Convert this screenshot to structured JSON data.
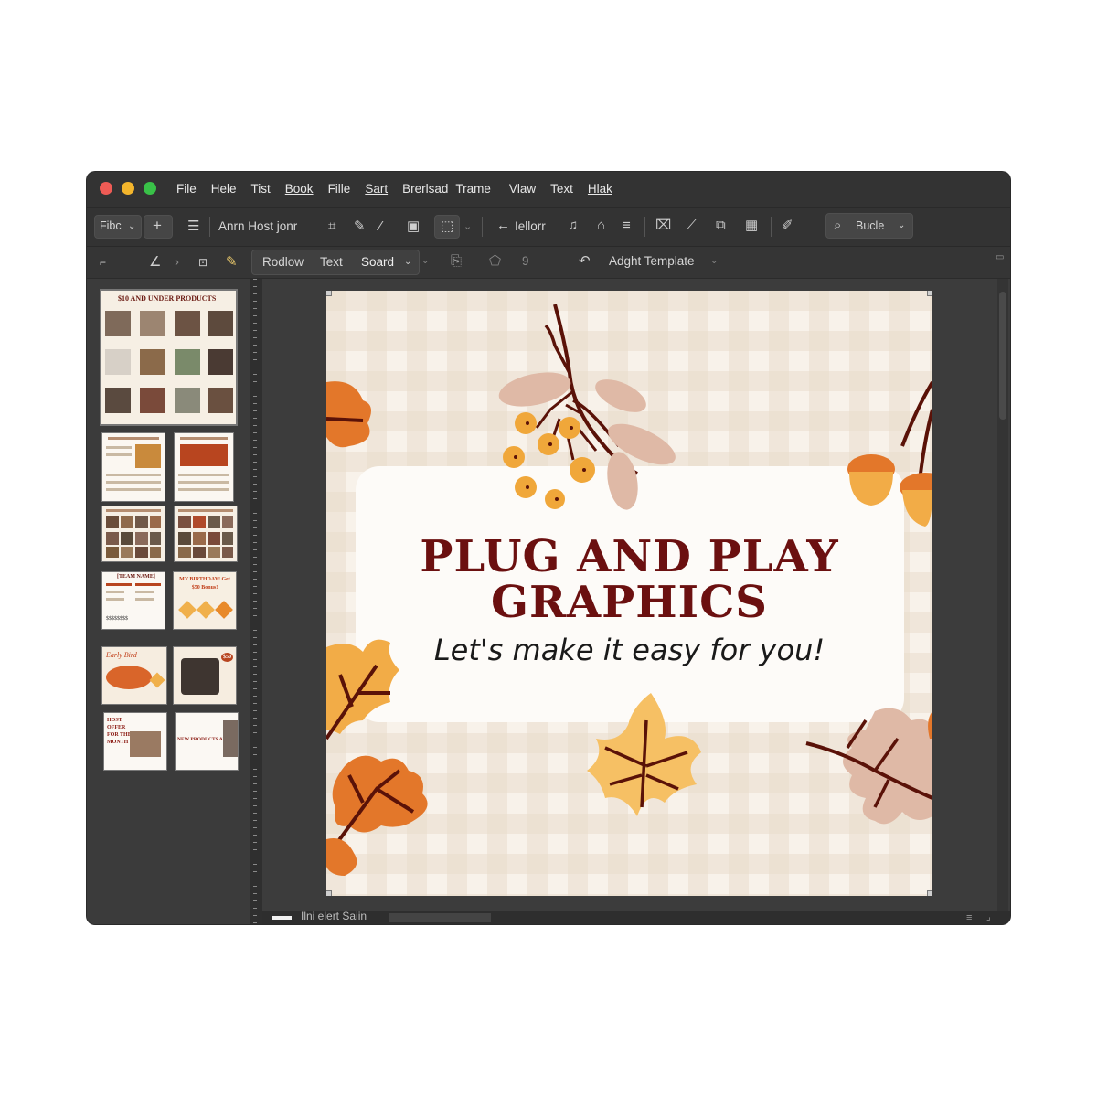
{
  "menubar": {
    "items": [
      "File",
      "Hele",
      "Tist",
      "Book",
      "Fille",
      "Sart",
      "Brerlsad",
      "Trame",
      "Vlaw",
      "Text",
      "Hlak"
    ]
  },
  "toolbar1": {
    "font_dropdown": "Fibc",
    "text_label": "Anrn Host jonr",
    "nav_label": "Iellorr",
    "search_label": "Bucle"
  },
  "toolbar2": {
    "tabs": [
      "Rodlow",
      "Text",
      "Soard"
    ],
    "number_value": "9",
    "template_label": "Adght Template"
  },
  "pages_panel": {
    "thumb1_title": "$10 AND UNDER PRODUCTS",
    "thumb4_title": "[TEAM NAME]",
    "thumb5_title": "MY BIRTHDAY! Get $50 Bonus!",
    "thumb6_title": "Early Bird",
    "thumb7_badge": "$50",
    "thumb8_title": "HOST OFFER FOR THE MONTH",
    "thumb9_title": "NEW PRODUCTS ALERT",
    "thumb4_footer": "$$$$$$$$"
  },
  "canvas": {
    "headline_line1": "PLUG AND PLAY",
    "headline_line2": "GRAPHICS",
    "subtitle": "Let's make it easy for you!"
  },
  "statusbar": {
    "label": "Ilni elert Saiin"
  },
  "colors": {
    "accent_dark_red": "#6b1010",
    "leaf_orange": "#e07a2a",
    "leaf_light": "#f3b25c",
    "leaf_beige": "#d9a98c",
    "branch": "#5a1208",
    "gingham": "#e9dccb"
  },
  "icons": [
    "close-dot",
    "minimize-dot",
    "zoom-dot",
    "plus-icon",
    "list-icon",
    "frame-icon",
    "pencil-icon",
    "brush-icon",
    "save-icon",
    "select-icon",
    "arrow-left-icon",
    "music-icon",
    "home-icon",
    "menu-icon",
    "trash-icon",
    "crop-icon",
    "grid-icon",
    "eyedropper-icon",
    "search-icon",
    "chevron-down-icon",
    "undo-icon"
  ]
}
